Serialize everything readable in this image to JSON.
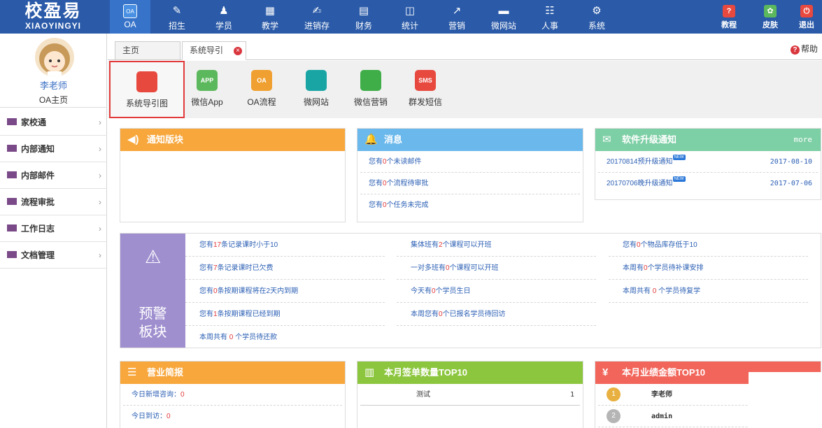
{
  "logo": {
    "cn": "校盈易",
    "en": "XIAOYINGYI"
  },
  "nav": [
    {
      "label": "OA",
      "icon": "oa-icon"
    },
    {
      "label": "招生",
      "icon": "recruit-icon"
    },
    {
      "label": "学员",
      "icon": "student-icon"
    },
    {
      "label": "教学",
      "icon": "teaching-icon"
    },
    {
      "label": "进销存",
      "icon": "inventory-icon"
    },
    {
      "label": "财务",
      "icon": "finance-icon"
    },
    {
      "label": "统计",
      "icon": "stats-icon"
    },
    {
      "label": "营销",
      "icon": "marketing-icon"
    },
    {
      "label": "微网站",
      "icon": "monitor-icon"
    },
    {
      "label": "人事",
      "icon": "hr-icon"
    },
    {
      "label": "系统",
      "icon": "gear-icon"
    }
  ],
  "nav_right": [
    {
      "label": "教程",
      "icon": "tutorial-icon"
    },
    {
      "label": "皮肤",
      "icon": "skin-icon"
    },
    {
      "label": "退出",
      "icon": "logout-icon"
    }
  ],
  "oa_icon_text": "OA",
  "user": {
    "name": "李老师",
    "home": "OA主页"
  },
  "menu": [
    {
      "label": "家校通"
    },
    {
      "label": "内部通知"
    },
    {
      "label": "内部邮件"
    },
    {
      "label": "流程审批"
    },
    {
      "label": "工作日志"
    },
    {
      "label": "文档管理"
    }
  ],
  "arrow": "›",
  "tabs": {
    "home": "主页",
    "guide": "系统导引",
    "close": "×"
  },
  "help": {
    "icon": "?",
    "label": "帮助"
  },
  "quick": [
    {
      "label": "系统导引图",
      "text": "",
      "color": "#e8493f"
    },
    {
      "label": "微信App",
      "text": "APP",
      "color": "#5cb85c"
    },
    {
      "label": "OA流程",
      "text": "OA",
      "color": "#f0a030"
    },
    {
      "label": "微网站",
      "text": "",
      "color": "#1aa5a5"
    },
    {
      "label": "微信营销",
      "text": "",
      "color": "#3fae49"
    },
    {
      "label": "群发短信",
      "text": "SMS",
      "color": "#e8493f"
    }
  ],
  "notice": {
    "title": "通知版块",
    "color": "#f8a73c"
  },
  "message": {
    "title": "消息",
    "color": "#6bb8ec",
    "items": [
      {
        "a": "您有",
        "n": "0",
        "b": "个未读邮件"
      },
      {
        "a": "您有",
        "n": "0",
        "b": "个流程待审批"
      },
      {
        "a": "您有",
        "n": "0",
        "b": "个任务未完成"
      }
    ]
  },
  "upgrade": {
    "title": "软件升级通知",
    "more": "more",
    "color": "#7dcfa5",
    "new_tag": "NEW",
    "items": [
      {
        "title": "20170814预升级通知",
        "date": "2017-08-10"
      },
      {
        "title": "20170706晚升级通知",
        "date": "2017-07-06"
      }
    ]
  },
  "warning": {
    "title1": "预警",
    "title2": "板块",
    "col1": [
      {
        "a": "您有",
        "n": "17",
        "b": "条记录课时小于10"
      },
      {
        "a": "您有",
        "n": "7",
        "b": "条记录课时已欠费"
      },
      {
        "a": "您有",
        "n": "0",
        "b": "条按期课程将在2天内到期"
      },
      {
        "a": "您有",
        "n": "1",
        "b": "条按期课程已经到期"
      },
      {
        "a": "本周共有 ",
        "n": "0",
        "b": " 个学员待还款"
      }
    ],
    "col2": [
      {
        "a": "集体班有",
        "n": "2",
        "b": "个课程可以开班"
      },
      {
        "a": "一对多班有",
        "n": "0",
        "b": "个课程可以开班"
      },
      {
        "a": "今天有",
        "n": "0",
        "b": "个学员生日"
      },
      {
        "a": "本周您有",
        "n": "0",
        "b": "个已报名学员待回访"
      }
    ],
    "col3": [
      {
        "a": "您有",
        "n": "0",
        "b": "个物品库存低于10"
      },
      {
        "a": "本周有",
        "n": "0",
        "b": "个学员待补课安排"
      },
      {
        "a": "本周共有 ",
        "n": "0",
        "b": " 个学员待复学"
      }
    ]
  },
  "business": {
    "title": "营业简报",
    "color": "#f8a73c",
    "items": [
      {
        "label": "今日新增咨询：",
        "value": "0"
      },
      {
        "label": "今日到访：",
        "value": "0"
      }
    ]
  },
  "signup": {
    "title": "本月签单数量TOP10",
    "color": "#8cc63e",
    "rows": [
      {
        "name": "测试",
        "count": "1"
      }
    ]
  },
  "perf": {
    "title": "本月业绩金额TOP10",
    "color": "#f2655a",
    "rows": [
      {
        "rank": "1",
        "name": "李老师"
      },
      {
        "rank": "2",
        "name": "admin"
      }
    ]
  }
}
